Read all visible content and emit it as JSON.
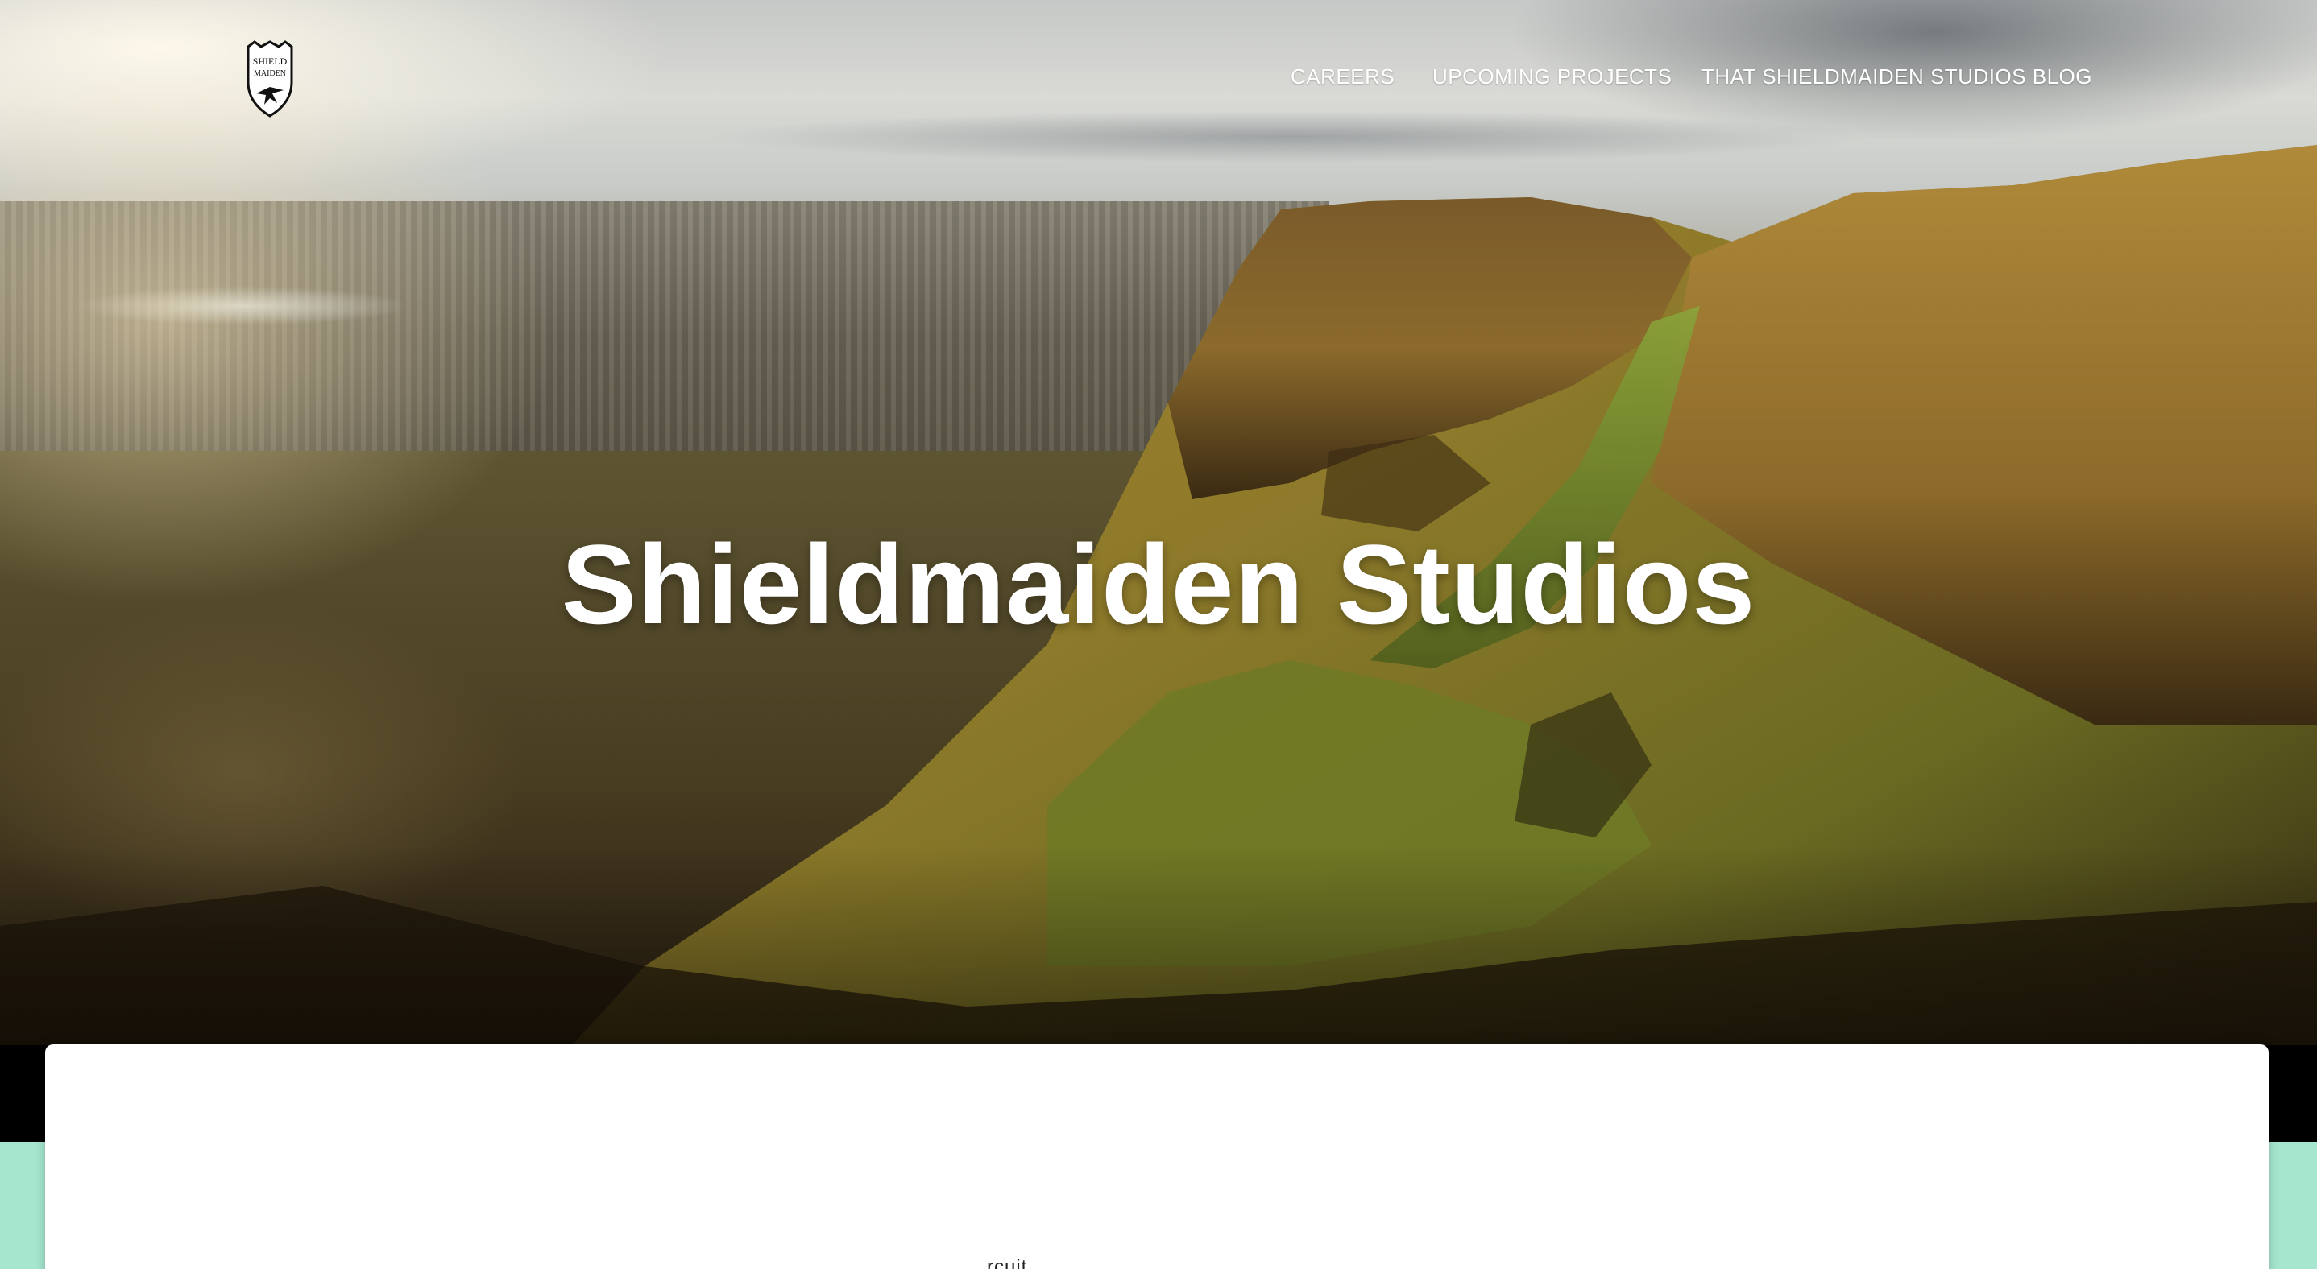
{
  "brand": {
    "logo_text_top": "SHIELD",
    "logo_text_bottom": "MAIDEN",
    "logo_icon": "shield-bird-icon"
  },
  "nav": {
    "items": [
      {
        "label": "CAREERS"
      },
      {
        "label": "UPCOMING PROJECTS"
      },
      {
        "label": "THAT SHIELDMAIDEN STUDIOS BLOG"
      }
    ]
  },
  "hero": {
    "title": "Shieldmaiden Studios"
  },
  "card": {
    "peek_text": "rcuit"
  },
  "colors": {
    "page_background": "#a6e6cf",
    "card_background": "#ffffff",
    "nav_text": "#ffffff",
    "hero_title": "#ffffff"
  }
}
